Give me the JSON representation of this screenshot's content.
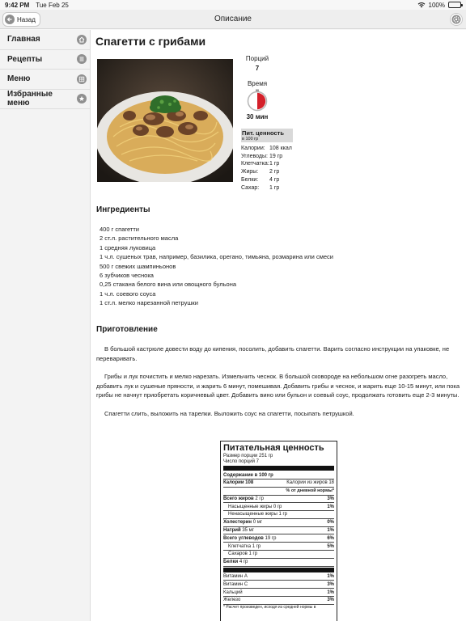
{
  "status_bar": {
    "time": "9:42 PM",
    "date": "Tue Feb 25",
    "battery": "100%"
  },
  "nav": {
    "back_label": "Назад",
    "title": "Описание"
  },
  "sidebar": {
    "items": [
      {
        "label": "Главная",
        "icon": "home-icon"
      },
      {
        "label": "Рецепты",
        "icon": "list-icon"
      },
      {
        "label": "Меню",
        "icon": "grid-icon"
      },
      {
        "label": "Избранные меню",
        "icon": "star-icon"
      }
    ]
  },
  "recipe": {
    "title": "Спагетти с грибами",
    "portions_label": "Порций",
    "portions_value": "7",
    "time_label": "Время",
    "time_value": "30 мин",
    "time_fraction": 0.5
  },
  "mini_nutrition": {
    "title": "Пит. ценность",
    "subtitle": "в 100 гр",
    "rows": [
      {
        "k": "Калории:",
        "v": "108 ккал"
      },
      {
        "k": "Углеводы:",
        "v": "19 гр"
      },
      {
        "k": "Клетчатка:",
        "v": "1 гр"
      },
      {
        "k": "Жиры:",
        "v": "2 гр"
      },
      {
        "k": "Белки:",
        "v": "4 гр"
      },
      {
        "k": "Сахар:",
        "v": "1 гр"
      }
    ]
  },
  "ingredients": {
    "heading": "Ингредиенты",
    "items": [
      "400 г спагетти",
      "2 ст.л. растительного масла",
      "1 средняя луковица",
      "1 ч.л. сушеных трав, например, базилика, орегано, тимьяна, розмарина или смеси",
      "500 г свежих шампиньонов",
      "6 зубчиков чеснока",
      "0,25 стакана белого вина или овощного бульона",
      "1 ч.л. соевого соуса",
      "1 ст.л. мелко нарезанной петрушки"
    ]
  },
  "preparation": {
    "heading": "Приготовление",
    "steps": [
      "В большой кастрюле довести воду до кипения, посолить, добавить спагетти. Варить согласно инструкции на упаковке, не переваривать.",
      "Грибы и лук почистить и мелко нарезать. Измельчить чеснок. В большой сковороде на небольшом огне разогреть масло, добавить лук и сушеные пряности, и жарить 6 минут, помешивая. Добавить грибы и чеснок, и жарить еще 10-15 минут, или пока грибы не начнут приобретать коричневый цвет. Добавить вино или бульон и соевый соус, продолжать готовить еще 2-3 минуты.",
      "Спагетти слить, выложить на тарелки. Выложить соус на спагетти, посыпать петрушкой."
    ]
  },
  "nutrition_label": {
    "title": "Питательная ценность",
    "serving_size": "Размер порции 251 гр",
    "servings": "Число порций 7",
    "content_per": "Содержание в 100 гр",
    "calories": "Калории 108",
    "calories_fat": "Калории из жиров 18",
    "dv_header": "% от дневной нормы*",
    "rows": [
      {
        "name": "Всего жиров",
        "amount": "2 гр",
        "pct": "3%",
        "bold": true,
        "indent": false
      },
      {
        "name": "Насыщенные жиры",
        "amount": "0 гр",
        "pct": "1%",
        "bold": false,
        "indent": true
      },
      {
        "name": "Ненасыщенные жиры",
        "amount": "1 гр",
        "pct": "",
        "bold": false,
        "indent": true
      },
      {
        "name": "Холестерин",
        "amount": "0 мг",
        "pct": "0%",
        "bold": true,
        "indent": false
      },
      {
        "name": "Натрий",
        "amount": "35 мг",
        "pct": "1%",
        "bold": true,
        "indent": false
      },
      {
        "name": "Всего углеводов",
        "amount": "19 гр",
        "pct": "6%",
        "bold": true,
        "indent": false
      },
      {
        "name": "Клетчатка",
        "amount": "1 гр",
        "pct": "5%",
        "bold": false,
        "indent": true
      },
      {
        "name": "Сахаров",
        "amount": "1 гр",
        "pct": "",
        "bold": false,
        "indent": true
      },
      {
        "name": "Белки",
        "amount": "4 гр",
        "pct": "",
        "bold": true,
        "indent": false
      }
    ],
    "vitamins": [
      {
        "name": "Витамин А",
        "pct": "1%"
      },
      {
        "name": "Витамин С",
        "pct": "3%"
      },
      {
        "name": "Кальций",
        "pct": "1%"
      },
      {
        "name": "Железо",
        "pct": "3%"
      }
    ],
    "footnote": "* Расчет произведен, исходя из средней нормы в"
  },
  "colors": {
    "timer_red": "#d4202a",
    "icon_grey": "#8f8f8f"
  }
}
